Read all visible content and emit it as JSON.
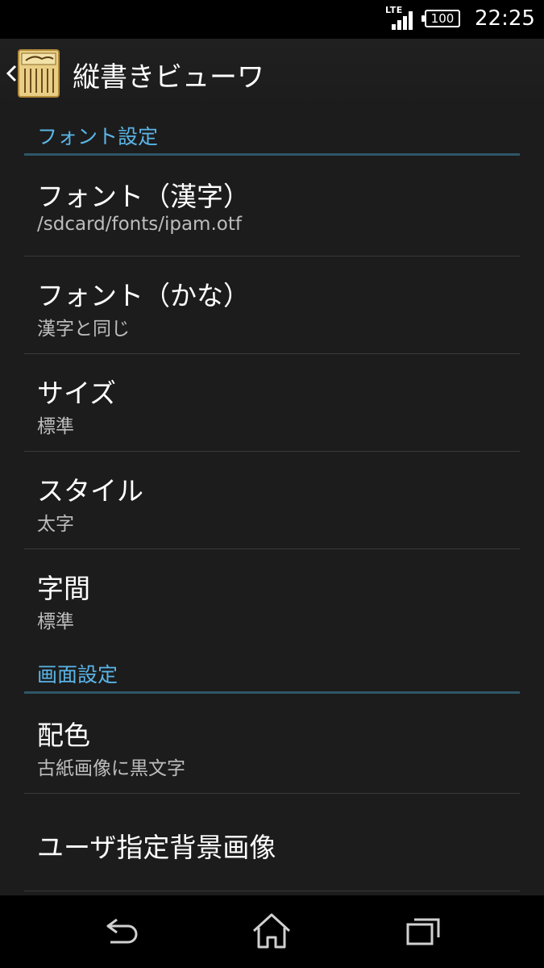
{
  "status_bar": {
    "network": "LTE",
    "battery": "100",
    "time": "22:25",
    "icons": [
      "signal-icon",
      "battery-icon"
    ]
  },
  "action_bar": {
    "title": "縦書きビューワ",
    "icons": [
      "back-caret-icon",
      "app-logo-icon"
    ]
  },
  "sections": [
    {
      "title": "フォント設定",
      "items": [
        {
          "title": "フォント（漢字）",
          "summary": "/sdcard/fonts/ipam.otf"
        },
        {
          "title": "フォント（かな）",
          "summary": "漢字と同じ"
        },
        {
          "title": "サイズ",
          "summary": "標準"
        },
        {
          "title": "スタイル",
          "summary": "太字"
        },
        {
          "title": "字間",
          "summary": "標準"
        }
      ]
    },
    {
      "title": "画面設定",
      "items": [
        {
          "title": "配色",
          "summary": "古紙画像に黒文字"
        },
        {
          "title": "ユーザ指定背景画像",
          "summary": ""
        }
      ]
    }
  ],
  "nav_bar": {
    "icons": [
      "back-icon",
      "home-icon",
      "recent-apps-icon"
    ]
  },
  "colors": {
    "accent": "#5ab4e6",
    "background": "#1c1c1c",
    "category_line": "#2f5667"
  }
}
